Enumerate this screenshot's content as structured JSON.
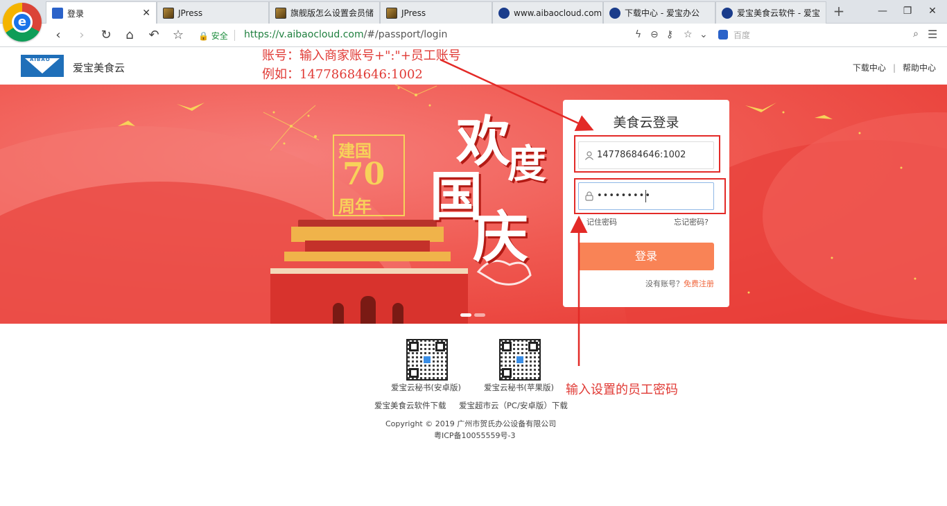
{
  "browser": {
    "tabs": [
      {
        "label": "登录",
        "active": true,
        "favicon": "blue-square"
      },
      {
        "label": "JPress",
        "favicon": "image-icon"
      },
      {
        "label": "旗舰版怎么设置会员储",
        "favicon": "image-icon"
      },
      {
        "label": "JPress",
        "favicon": "image-icon"
      },
      {
        "label": "www.aibaocloud.com",
        "favicon": "cloud-icon"
      },
      {
        "label": "下载中心 - 爱宝办公",
        "favicon": "cloud-icon"
      },
      {
        "label": "爱宝美食云软件 - 爱宝",
        "favicon": "cloud-icon"
      }
    ],
    "secure_label": "安全",
    "url_main": "https://v.aibaocloud.com",
    "url_rest": "/#/passport/login",
    "search_placeholder": "百度"
  },
  "site": {
    "name": "爱宝美食云",
    "logo_text": "AIBAO",
    "header_links": [
      "下载中心",
      "帮助中心"
    ]
  },
  "banner": {
    "badge_top": "建国",
    "badge_num": "70",
    "badge_bottom": "周年",
    "calligraphy": [
      "欢",
      "度",
      "国",
      "庆"
    ]
  },
  "login": {
    "title": "美食云登录",
    "username_value": "14778684646:1002",
    "password_mask": "•••••••••",
    "remember_label": "记住密码",
    "forgot_label": "忘记密码?",
    "submit_label": "登录",
    "no_account_text": "没有账号？",
    "register_label": "免费注册"
  },
  "annotations": {
    "account_line1": "账号：输入商家账号+\":\"+员工账号",
    "account_line2": "例如：14778684646:1002",
    "password_note": "输入设置的员工密码"
  },
  "footer": {
    "qr_android_label": "爱宝云秘书(安卓版)",
    "qr_ios_label": "爱宝云秘书(苹果版)",
    "download_link_1": "爱宝美食云软件下载",
    "download_link_2": "爱宝超市云（PC/安卓版）下载",
    "copyright": "Copyright © 2019 广州市贺氏办公设备有限公司",
    "icp": "粤ICP备10055559号-3"
  },
  "colors": {
    "accent": "#f98356",
    "annotation_red": "#e32a27",
    "banner_red": "#f05a52"
  }
}
